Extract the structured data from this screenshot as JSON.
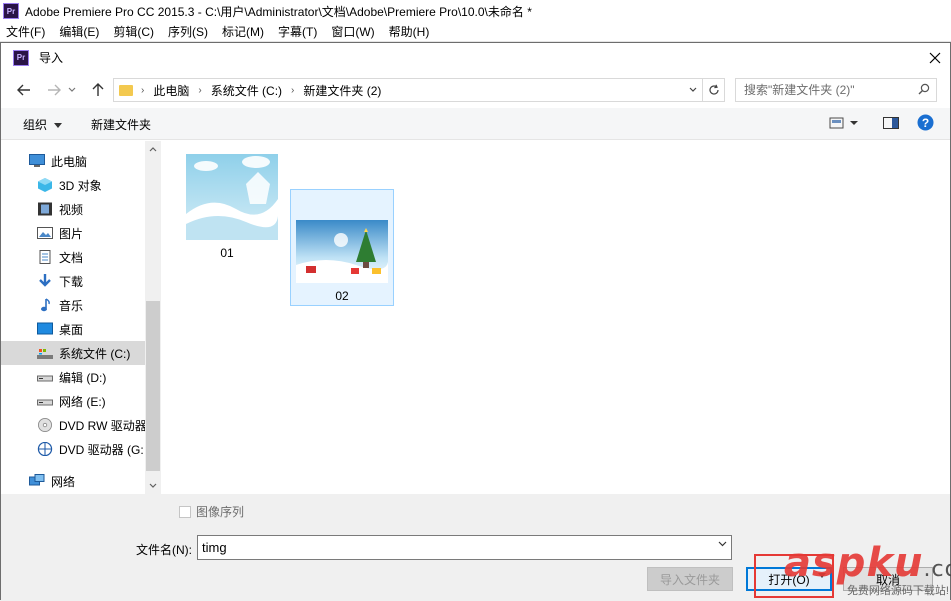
{
  "app": {
    "logo_text": "Pr",
    "title": "Adobe Premiere Pro CC 2015.3 - C:\\用户\\Administrator\\文档\\Adobe\\Premiere Pro\\10.0\\未命名 *",
    "menus": [
      "文件(F)",
      "编辑(E)",
      "剪辑(C)",
      "序列(S)",
      "标记(M)",
      "字幕(T)",
      "窗口(W)",
      "帮助(H)"
    ]
  },
  "dialog": {
    "title": "导入",
    "breadcrumbs": [
      "此电脑",
      "系统文件 (C:)",
      "新建文件夹 (2)"
    ],
    "search_placeholder": "搜索\"新建文件夹 (2)\"",
    "toolbar": {
      "organize": "组织",
      "new_folder": "新建文件夹"
    },
    "nav": [
      {
        "label": "此电脑",
        "icon": "computer-icon",
        "level": 0,
        "selected": false
      },
      {
        "label": "3D 对象",
        "icon": "3d-objects-icon",
        "level": 1,
        "selected": false
      },
      {
        "label": "视频",
        "icon": "video-icon",
        "level": 1,
        "selected": false
      },
      {
        "label": "图片",
        "icon": "pictures-icon",
        "level": 1,
        "selected": false
      },
      {
        "label": "文档",
        "icon": "documents-icon",
        "level": 1,
        "selected": false
      },
      {
        "label": "下载",
        "icon": "downloads-icon",
        "level": 1,
        "selected": false
      },
      {
        "label": "音乐",
        "icon": "music-icon",
        "level": 1,
        "selected": false
      },
      {
        "label": "桌面",
        "icon": "desktop-icon",
        "level": 1,
        "selected": false
      },
      {
        "label": "系统文件 (C:)",
        "icon": "system-drive-icon",
        "level": 1,
        "selected": true
      },
      {
        "label": "编辑 (D:)",
        "icon": "drive-icon",
        "level": 1,
        "selected": false
      },
      {
        "label": "网络 (E:)",
        "icon": "drive-icon",
        "level": 1,
        "selected": false
      },
      {
        "label": "DVD RW 驱动器",
        "icon": "dvd-rw-icon",
        "level": 1,
        "selected": false
      },
      {
        "label": "DVD 驱动器 (G:",
        "icon": "dvd-icon",
        "level": 1,
        "selected": false
      },
      {
        "label": "网络",
        "icon": "network-icon",
        "level": 0,
        "selected": false
      }
    ],
    "files": [
      {
        "name": "01",
        "thumb": "winter-blue-background",
        "selected": false
      },
      {
        "name": "02",
        "thumb": "christmas-tree-scene",
        "selected": true
      }
    ],
    "image_sequence_label": "图像序列",
    "filename_label": "文件名(N):",
    "filename_value": "timg",
    "buttons": {
      "import_folder": "导入文件夹",
      "open": "打开(O)",
      "cancel": "取消"
    }
  },
  "watermark": {
    "logo": "asp",
    "logo_suffix": "ku",
    "domain_suffix": ".com",
    "subtitle": "免费网络源码下载站!"
  },
  "colors": {
    "accent": "#0078d7",
    "selection": "#e5f3ff",
    "selection_border": "#99d1ff",
    "folder": "#f3c94f",
    "watermark_red": "#e53935"
  }
}
